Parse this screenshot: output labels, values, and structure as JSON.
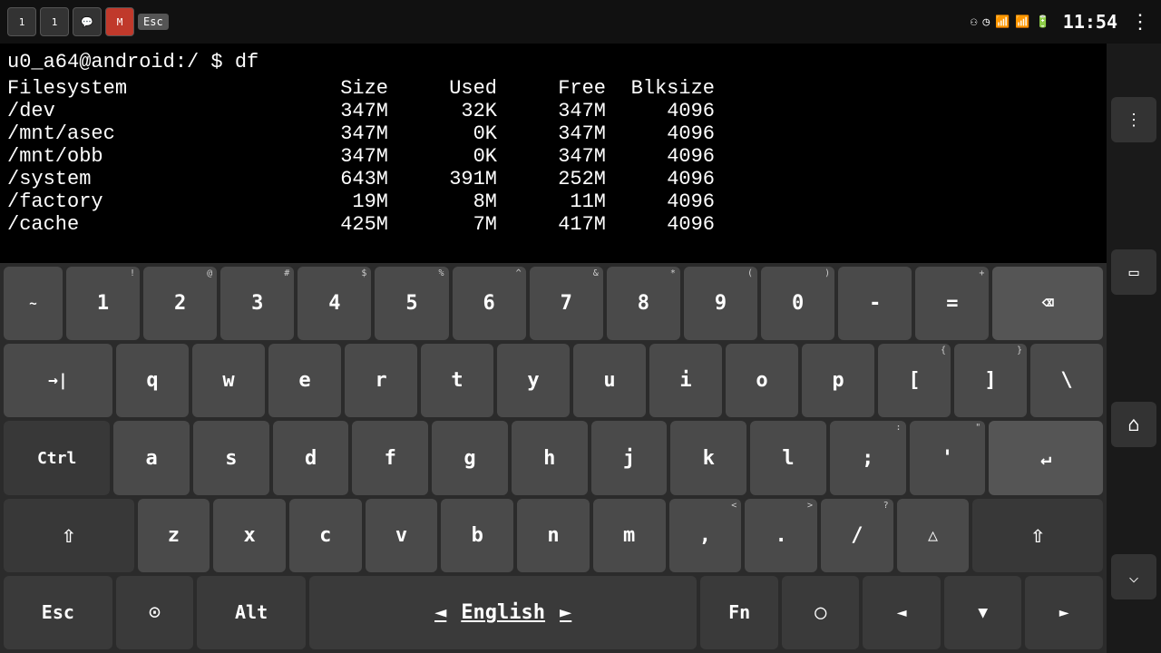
{
  "statusBar": {
    "time": "11:54",
    "apps": [
      "1",
      "1"
    ],
    "escLabel": "Esc",
    "icons": [
      "bluetooth",
      "alarm",
      "wifi",
      "signal",
      "battery"
    ]
  },
  "terminal": {
    "prompt": "u0_a64@android:/ $ df",
    "headers": "Filesystem        Size    Used    Free   Blksize",
    "rows": [
      {
        "fs": "/dev",
        "size": "347M",
        "used": "32K",
        "free": "347M",
        "blksize": "4096"
      },
      {
        "fs": "/mnt/asec",
        "size": "347M",
        "used": "0K",
        "free": "347M",
        "blksize": "4096"
      },
      {
        "fs": "/mnt/obb",
        "size": "347M",
        "used": "0K",
        "free": "347M",
        "blksize": "4096"
      },
      {
        "fs": "/system",
        "size": "643M",
        "used": "391M",
        "free": "252M",
        "blksize": "4096"
      },
      {
        "fs": "/factory",
        "size": "19M",
        "used": "8M",
        "free": "11M",
        "blksize": "4096"
      },
      {
        "fs": "/cache",
        "size": "425M",
        "used": "7M",
        "free": "417M",
        "blksize": "4096"
      }
    ]
  },
  "keyboard": {
    "row1": [
      {
        "label": "~",
        "sub": ""
      },
      {
        "label": "1",
        "sub": "!"
      },
      {
        "label": "2",
        "sub": "@"
      },
      {
        "label": "3",
        "sub": "#"
      },
      {
        "label": "4",
        "sub": "$"
      },
      {
        "label": "5",
        "sub": "%"
      },
      {
        "label": "6",
        "sub": "^"
      },
      {
        "label": "7",
        "sub": "&"
      },
      {
        "label": "8",
        "sub": "*"
      },
      {
        "label": "9",
        "sub": "("
      },
      {
        "label": "0",
        "sub": ")"
      },
      {
        "label": "-",
        "sub": "_"
      },
      {
        "label": "=",
        "sub": "+"
      },
      {
        "label": "⌫",
        "sub": ""
      }
    ],
    "row2": [
      {
        "label": "⇥",
        "sub": ""
      },
      {
        "label": "q"
      },
      {
        "label": "w"
      },
      {
        "label": "e"
      },
      {
        "label": "r"
      },
      {
        "label": "t"
      },
      {
        "label": "y"
      },
      {
        "label": "u"
      },
      {
        "label": "i"
      },
      {
        "label": "o"
      },
      {
        "label": "p"
      },
      {
        "label": "[",
        "sub": "{"
      },
      {
        "label": "]",
        "sub": "}"
      },
      {
        "label": "\\",
        "sub": "|"
      }
    ],
    "row3": [
      {
        "label": "Ctrl",
        "sub": ""
      },
      {
        "label": "a"
      },
      {
        "label": "s"
      },
      {
        "label": "d"
      },
      {
        "label": "f"
      },
      {
        "label": "g"
      },
      {
        "label": "h"
      },
      {
        "label": "j"
      },
      {
        "label": "k"
      },
      {
        "label": "l"
      },
      {
        "label": ";",
        "sub": ":"
      },
      {
        "label": "'",
        "sub": "\""
      },
      {
        "label": "↵",
        "sub": ""
      }
    ],
    "row4": [
      {
        "label": "⇧",
        "sub": ""
      },
      {
        "label": "z"
      },
      {
        "label": "x"
      },
      {
        "label": "c"
      },
      {
        "label": "v"
      },
      {
        "label": "b"
      },
      {
        "label": "n"
      },
      {
        "label": "m"
      },
      {
        "label": ",",
        "sub": "<"
      },
      {
        "label": ".",
        "sub": ">"
      },
      {
        "label": "/",
        "sub": "?"
      },
      {
        "label": "△",
        "sub": ""
      },
      {
        "label": "⇧",
        "sub": ""
      }
    ],
    "row5": {
      "esc": "Esc",
      "settings": "⊙",
      "alt": "Alt",
      "langPrev": "◄",
      "lang": "English",
      "langNext": "►",
      "fn": "Fn",
      "home": "○",
      "left": "◄",
      "down": "▼",
      "right": "►"
    }
  },
  "rightNav": {
    "menu": "⋮",
    "window": "▭",
    "home": "⌂",
    "back": "⌵"
  }
}
